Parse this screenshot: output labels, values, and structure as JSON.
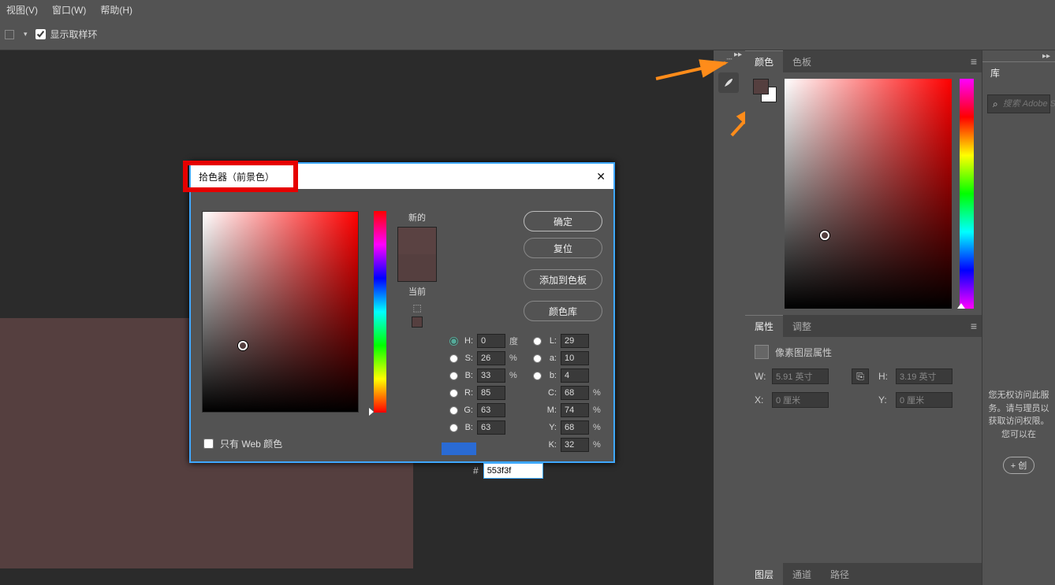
{
  "menu": {
    "view": "视图(V)",
    "window": "窗口(W)",
    "help": "帮助(H)"
  },
  "optbar": {
    "sample_ring": "显示取样环"
  },
  "panels": {
    "color": {
      "tab_color": "颜色",
      "tab_swatches": "色板"
    },
    "props": {
      "tab_props": "属性",
      "tab_adjust": "调整",
      "title": "像素图层属性",
      "w": "W:",
      "w_val": "5.91 英寸",
      "h": "H:",
      "h_val": "3.19 英寸",
      "x": "X:",
      "x_val": "0 厘米",
      "y": "Y:",
      "y_val": "0 厘米"
    },
    "layers": {
      "tab_layers": "图层",
      "tab_channels": "通道",
      "tab_paths": "路径"
    }
  },
  "lib": {
    "tab": "库",
    "search_ph": "搜索 Adobe St",
    "msg": "您无权访问此服务。请与理员以获取访问权限。您可以在",
    "add": "+ 创"
  },
  "dialog": {
    "title": "拾色器（前景色）",
    "new": "新的",
    "current": "当前",
    "ok": "确定",
    "reset": "复位",
    "add": "添加到色板",
    "libs": "颜色库",
    "h": "H:",
    "h_val": "0",
    "h_unit": "度",
    "s": "S:",
    "s_val": "26",
    "pct": "%",
    "b": "B:",
    "b_val": "33",
    "r": "R:",
    "r_val": "85",
    "g": "G:",
    "g_val": "63",
    "bb": "B:",
    "bb_val": "63",
    "l": "L:",
    "l_val": "29",
    "a": "a:",
    "a_val": "10",
    "lb": "b:",
    "lb_val": "4",
    "c": "C:",
    "c_val": "68",
    "m": "M:",
    "m_val": "74",
    "yk": "Y:",
    "yk_val": "68",
    "k": "K:",
    "k_val": "32",
    "hex": "553f3f",
    "web": "只有 Web 颜色"
  },
  "colors": {
    "current": "#553f3f",
    "new": "#5a4242"
  }
}
